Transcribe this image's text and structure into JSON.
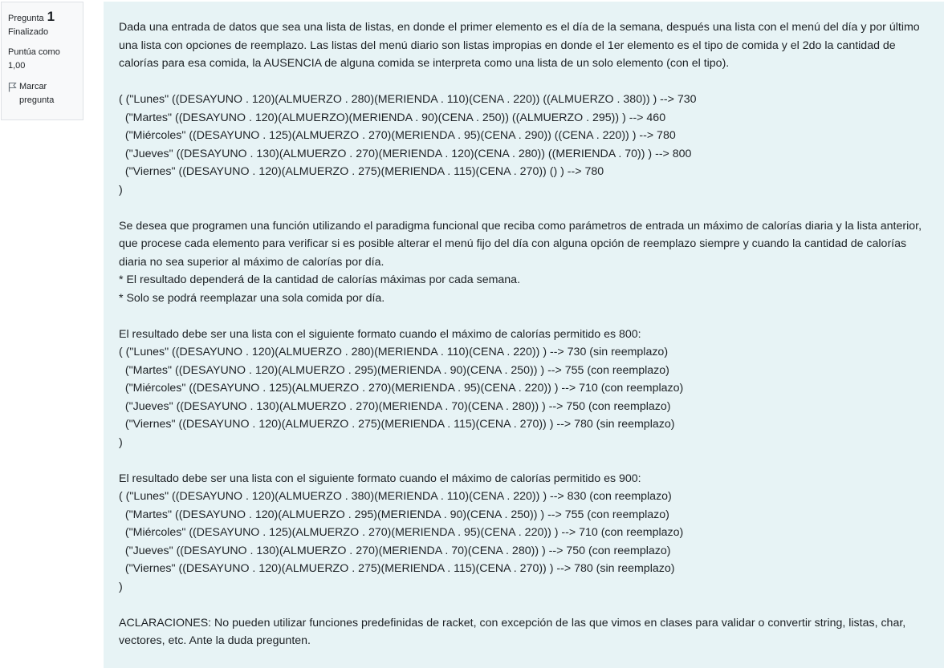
{
  "info": {
    "question_label": "Pregunta",
    "question_number": "1",
    "state": "Finalizado",
    "grade_label": "Puntúa como",
    "grade_value": "1,00",
    "flag_label": "Marcar pregunta",
    "flag_icon": "flag-icon"
  },
  "question": {
    "intro": "Dada una entrada de datos que sea una lista de listas, en donde el primer elemento es el día de la semana, después una lista con el menú del día y por último una lista con opciones de reemplazo. Las listas del menú diario son listas impropias en donde el 1er elemento es el tipo de comida y el 2do la cantidad de calorías para esa comida, la AUSENCIA de alguna comida se interpreta como una lista de un solo elemento (con el tipo).",
    "input_example": [
      "( (\"Lunes\" ((DESAYUNO . 120)(ALMUERZO . 280)(MERIENDA . 110)(CENA . 220)) ((ALMUERZO . 380)) ) --> 730",
      "  (\"Martes\" ((DESAYUNO . 120)(ALMUERZO)(MERIENDA . 90)(CENA . 250)) ((ALMUERZO . 295)) ) --> 460",
      "  (\"Miércoles\" ((DESAYUNO . 125)(ALMUERZO . 270)(MERIENDA . 95)(CENA . 290)) ((CENA . 220)) ) --> 780",
      "  (\"Jueves\" ((DESAYUNO . 130)(ALMUERZO . 270)(MERIENDA . 120)(CENA . 280)) ((MERIENDA . 70)) ) --> 800",
      "  (\"Viernes\" ((DESAYUNO . 120)(ALMUERZO . 275)(MERIENDA . 115)(CENA . 270)) () ) --> 780",
      ")"
    ],
    "task": "Se desea que programen una función utilizando el paradigma funcional que reciba como parámetros de entrada un máximo de calorías diaria y la lista anterior, que procese cada elemento para verificar si es posible alterar el menú fijo del día con alguna opción de reemplazo siempre y cuando la cantidad de calorías diaria no sea superior al máximo de calorías por día.",
    "note_1": "* El resultado dependerá de la cantidad de calorías máximas por cada semana.",
    "note_2": "* Solo se podrá reemplazar una sola comida por día.",
    "result_800_heading": "El resultado debe ser una lista con el siguiente formato cuando el máximo de calorías permitido es 800:",
    "result_800": [
      "( (\"Lunes\" ((DESAYUNO . 120)(ALMUERZO . 280)(MERIENDA . 110)(CENA . 220)) ) --> 730 (sin reemplazo)",
      "  (\"Martes\" ((DESAYUNO . 120)(ALMUERZO . 295)(MERIENDA . 90)(CENA . 250)) ) --> 755 (con reemplazo)",
      "  (\"Miércoles\" ((DESAYUNO . 125)(ALMUERZO . 270)(MERIENDA . 95)(CENA . 220)) ) --> 710 (con reemplazo)",
      "  (\"Jueves\" ((DESAYUNO . 130)(ALMUERZO . 270)(MERIENDA . 70)(CENA . 280)) ) --> 750 (con reemplazo)",
      "  (\"Viernes\" ((DESAYUNO . 120)(ALMUERZO . 275)(MERIENDA . 115)(CENA . 270)) ) --> 780 (sin reemplazo)",
      ")"
    ],
    "result_900_heading": "El resultado debe ser una lista con el siguiente formato cuando el máximo de calorías permitido es 900:",
    "result_900": [
      "( (\"Lunes\" ((DESAYUNO . 120)(ALMUERZO . 380)(MERIENDA . 110)(CENA . 220)) ) --> 830 (con reemplazo)",
      "  (\"Martes\" ((DESAYUNO . 120)(ALMUERZO . 295)(MERIENDA . 90)(CENA . 250)) ) --> 755 (con reemplazo)",
      "  (\"Miércoles\" ((DESAYUNO . 125)(ALMUERZO . 270)(MERIENDA . 95)(CENA . 220)) ) --> 710 (con reemplazo)",
      "  (\"Jueves\" ((DESAYUNO . 130)(ALMUERZO . 270)(MERIENDA . 70)(CENA . 280)) ) --> 750 (con reemplazo)",
      "  (\"Viernes\" ((DESAYUNO . 120)(ALMUERZO . 275)(MERIENDA . 115)(CENA . 270)) ) --> 780 (sin reemplazo)",
      ")"
    ],
    "clarifications": "ACLARACIONES: No pueden utilizar funciones predefinidas de racket, con excepción de las que vimos en clases para validar o convertir string, listas, char, vectores, etc. Ante la duda pregunten."
  }
}
